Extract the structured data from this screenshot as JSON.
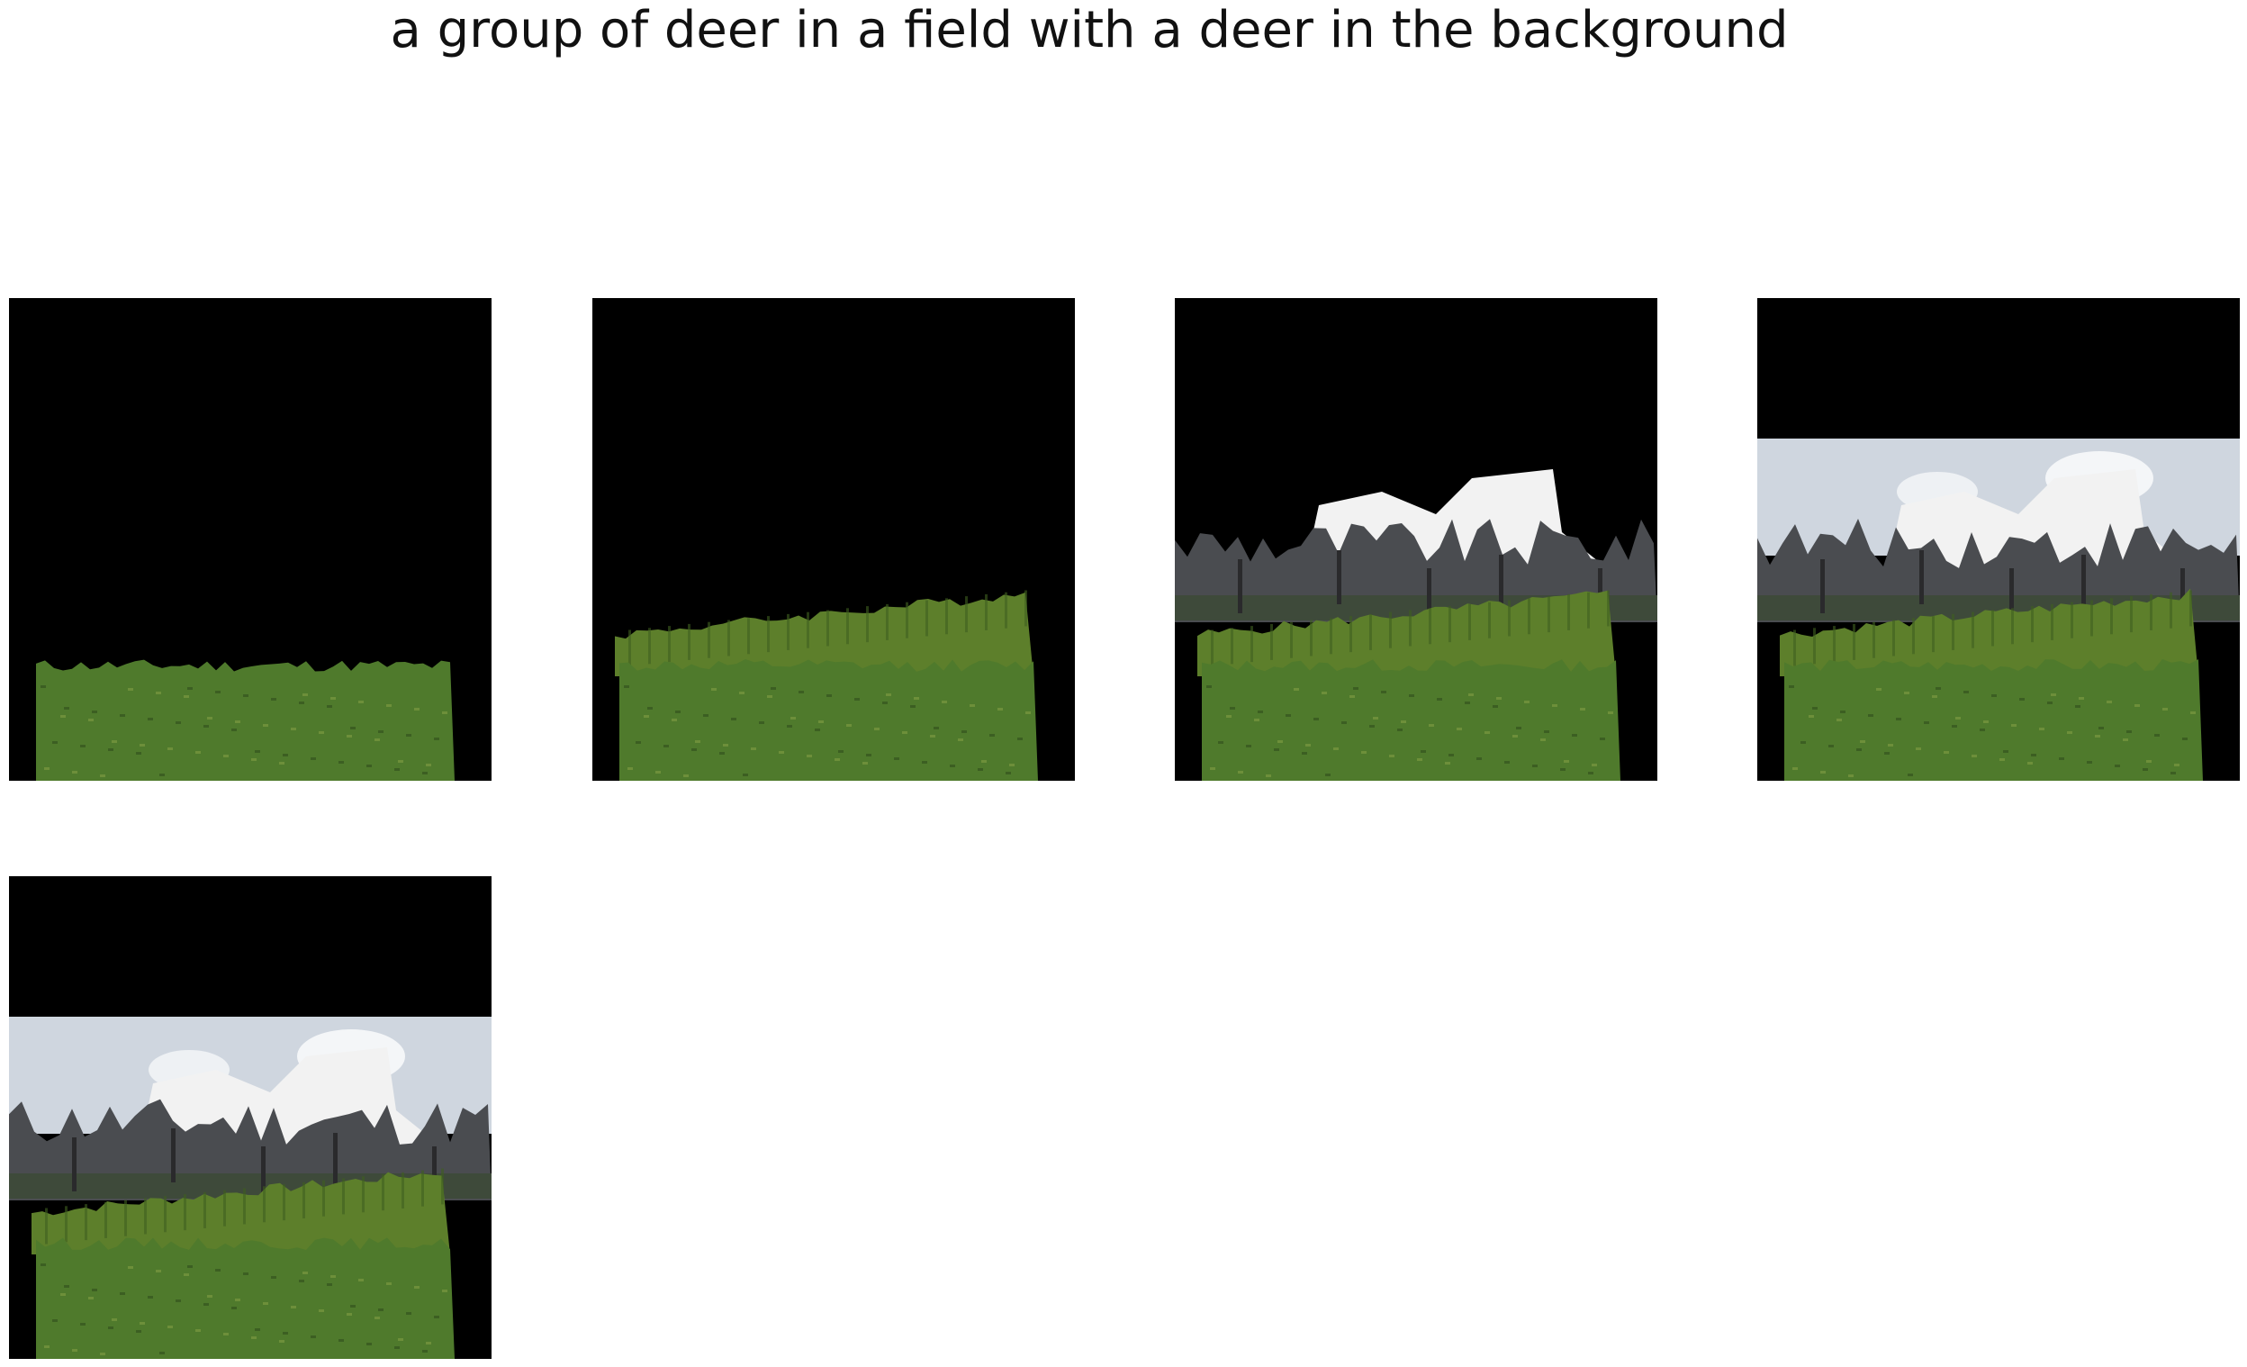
{
  "title": "a group of deer in a field with a deer in the background",
  "panels": [
    {
      "name": "panel-1",
      "layers": [
        "field"
      ]
    },
    {
      "name": "panel-2",
      "layers": [
        "field",
        "hedge"
      ]
    },
    {
      "name": "panel-3",
      "layers": [
        "field",
        "hedge",
        "trees"
      ]
    },
    {
      "name": "panel-4",
      "layers": [
        "field",
        "hedge",
        "trees",
        "sky"
      ]
    },
    {
      "name": "panel-5",
      "layers": [
        "field",
        "hedge",
        "trees",
        "sky"
      ]
    }
  ],
  "colors": {
    "background": "#000000",
    "field": "#4f7a2c",
    "hedge": "#5d7f2b",
    "trees": "#4a4c50",
    "sky": "#cfd6df"
  }
}
